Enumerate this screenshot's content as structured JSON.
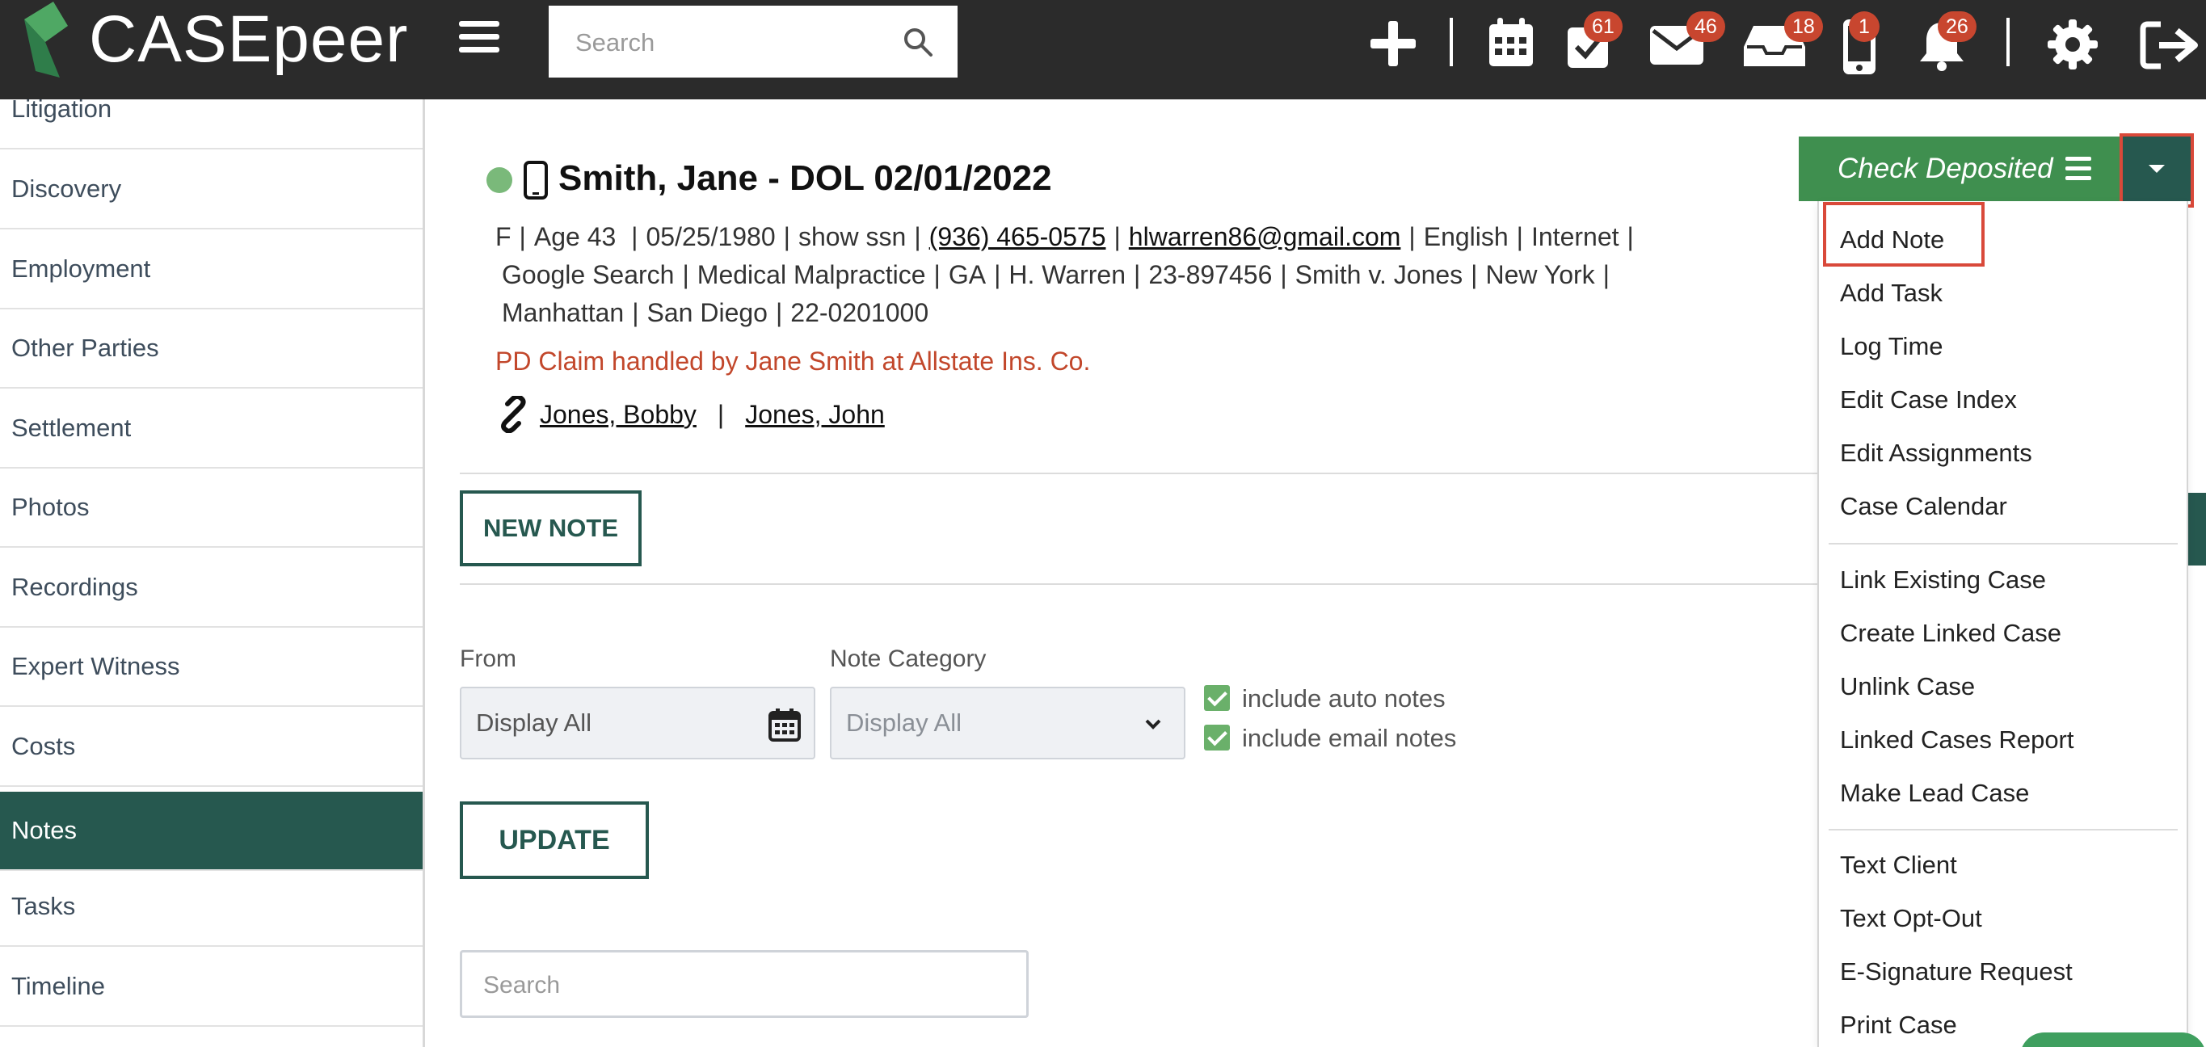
{
  "app": {
    "name": "CASEpeer",
    "search_placeholder": "Search"
  },
  "topbar": {
    "icons": [
      {
        "name": "plus-icon"
      },
      {
        "name": "calendar-icon"
      },
      {
        "name": "tasks-icon",
        "badge": "61"
      },
      {
        "name": "mail-icon",
        "badge": "46"
      },
      {
        "name": "inbox-icon",
        "badge": "18"
      },
      {
        "name": "phone-icon",
        "badge": "1"
      },
      {
        "name": "bell-icon",
        "badge": "26"
      },
      {
        "name": "gear-icon"
      },
      {
        "name": "logout-icon"
      }
    ]
  },
  "sidebar": {
    "items": [
      {
        "label": "Litigation"
      },
      {
        "label": "Discovery"
      },
      {
        "label": "Employment"
      },
      {
        "label": "Other Parties"
      },
      {
        "label": "Settlement"
      },
      {
        "label": "Photos"
      },
      {
        "label": "Recordings"
      },
      {
        "label": "Expert Witness"
      },
      {
        "label": "Costs"
      },
      {
        "label": "Notes",
        "active": true
      },
      {
        "label": "Tasks"
      },
      {
        "label": "Timeline"
      }
    ]
  },
  "case": {
    "title": "Smith, Jane - DOL 02/01/2022",
    "line1": {
      "sex": "F",
      "age": "Age 43",
      "dob": "05/25/1980",
      "ssn": "show ssn",
      "phone": "(936) 465-0575",
      "email": "hlwarren86@gmail.com",
      "language": "English",
      "source": "Internet"
    },
    "line2": {
      "referral": "Google Search",
      "case_type": "Medical Malpractice",
      "state": "GA",
      "attorney": "H. Warren",
      "case_number": "23-897456",
      "caption": "Smith v. Jones",
      "venue": "New York"
    },
    "line3": {
      "county": "Manhattan",
      "office": "San Diego",
      "file_number": "22-0201000"
    },
    "pd_claim": "PD Claim handled by Jane Smith at Allstate Ins. Co.",
    "linked": [
      "Jones, Bobby",
      "Jones, John"
    ]
  },
  "notes": {
    "new_note_label": "NEW NOTE",
    "from_label": "From",
    "from_value": "Display All",
    "category_label": "Note Category",
    "category_value": "Display All",
    "include_auto": "include auto notes",
    "include_email": "include email notes",
    "update_label": "UPDATE",
    "search_placeholder": "Search"
  },
  "actions": {
    "status_label": "Check Deposited",
    "menu_group1": [
      "Add Note",
      "Add Task",
      "Log Time",
      "Edit Case Index",
      "Edit Assignments",
      "Case Calendar"
    ],
    "menu_group2": [
      "Link Existing Case",
      "Create Linked Case",
      "Unlink Case",
      "Linked Cases Report",
      "Make Lead Case"
    ],
    "menu_group3": [
      "Text Client",
      "Text Opt-Out",
      "E-Signature Request",
      "Print Case"
    ]
  },
  "colors": {
    "topbar": "#2b2b2b",
    "brand_green": "#26584f",
    "status_green": "#3f8f4f",
    "badge_red": "#c8462f",
    "claim_red": "#c2472b",
    "highlight_red": "#d9493a"
  }
}
